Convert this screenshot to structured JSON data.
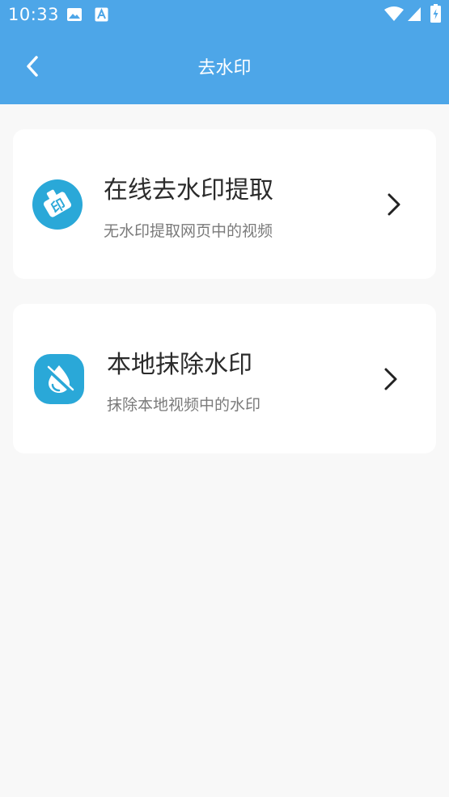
{
  "status_bar": {
    "time": "10:33",
    "icons": [
      "image-icon",
      "text-a-icon",
      "wifi-icon",
      "signal-icon",
      "battery-icon"
    ]
  },
  "nav": {
    "title": "去水印",
    "back_icon": "chevron-left-icon"
  },
  "cards": [
    {
      "title": "在线去水印提取",
      "subtitle": "无水印提取网页中的视频",
      "icon": "stamp-icon"
    },
    {
      "title": "本地抹除水印",
      "subtitle": "抹除本地视频中的水印",
      "icon": "erase-drop-icon"
    }
  ],
  "colors": {
    "header": "#4da6e8",
    "background": "#f8f8f8",
    "card": "#ffffff",
    "icon_blue": "#2aa8d8"
  }
}
